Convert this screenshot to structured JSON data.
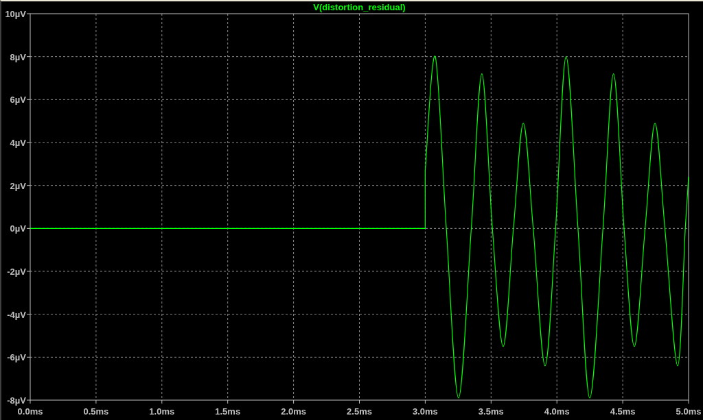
{
  "plot": {
    "chart_data": {
      "type": "line",
      "grid": true,
      "x": [
        0,
        3.0,
        3.0,
        3.076,
        3.16,
        3.253,
        3.35,
        3.43,
        3.51,
        3.592,
        3.67,
        3.745,
        3.82,
        3.91,
        3.99,
        4.07,
        4.16,
        4.25,
        4.35,
        4.43,
        4.51,
        4.588,
        4.67,
        4.745,
        4.82,
        4.917,
        4.975,
        5.0
      ],
      "series": [
        {
          "name": "V(distortion_residual)",
          "color": "#00ff00",
          "values": [
            0,
            0,
            2.7,
            8.0,
            0,
            -7.9,
            0,
            7.2,
            0,
            -5.5,
            0,
            4.9,
            0,
            -6.4,
            0,
            8.0,
            0,
            -7.9,
            0,
            7.2,
            0,
            -5.5,
            0,
            4.9,
            0,
            -6.4,
            0,
            2.4
          ]
        }
      ],
      "xlim": [
        0,
        5
      ],
      "ylim": [
        -8,
        10
      ],
      "xticks": [
        {
          "value": 0,
          "label": "0.0ms"
        },
        {
          "value": 0.5,
          "label": "0.5ms"
        },
        {
          "value": 1,
          "label": "1.0ms"
        },
        {
          "value": 1.5,
          "label": "1.5ms"
        },
        {
          "value": 2,
          "label": "2.0ms"
        },
        {
          "value": 2.5,
          "label": "2.5ms"
        },
        {
          "value": 3,
          "label": "3.0ms"
        },
        {
          "value": 3.5,
          "label": "3.5ms"
        },
        {
          "value": 4,
          "label": "4.0ms"
        },
        {
          "value": 4.5,
          "label": "4.5ms"
        },
        {
          "value": 5,
          "label": "5.0ms"
        }
      ],
      "yticks": [
        {
          "value": 10,
          "label": "10µV"
        },
        {
          "value": 8,
          "label": "8µV"
        },
        {
          "value": 6,
          "label": "6µV"
        },
        {
          "value": 4,
          "label": "4µV"
        },
        {
          "value": 2,
          "label": "2µV"
        },
        {
          "value": 0,
          "label": "0µV"
        },
        {
          "value": -2,
          "label": "-2µV"
        },
        {
          "value": -4,
          "label": "-4µV"
        },
        {
          "value": -6,
          "label": "-6µV"
        },
        {
          "value": -8,
          "label": "-8µV"
        }
      ]
    }
  }
}
